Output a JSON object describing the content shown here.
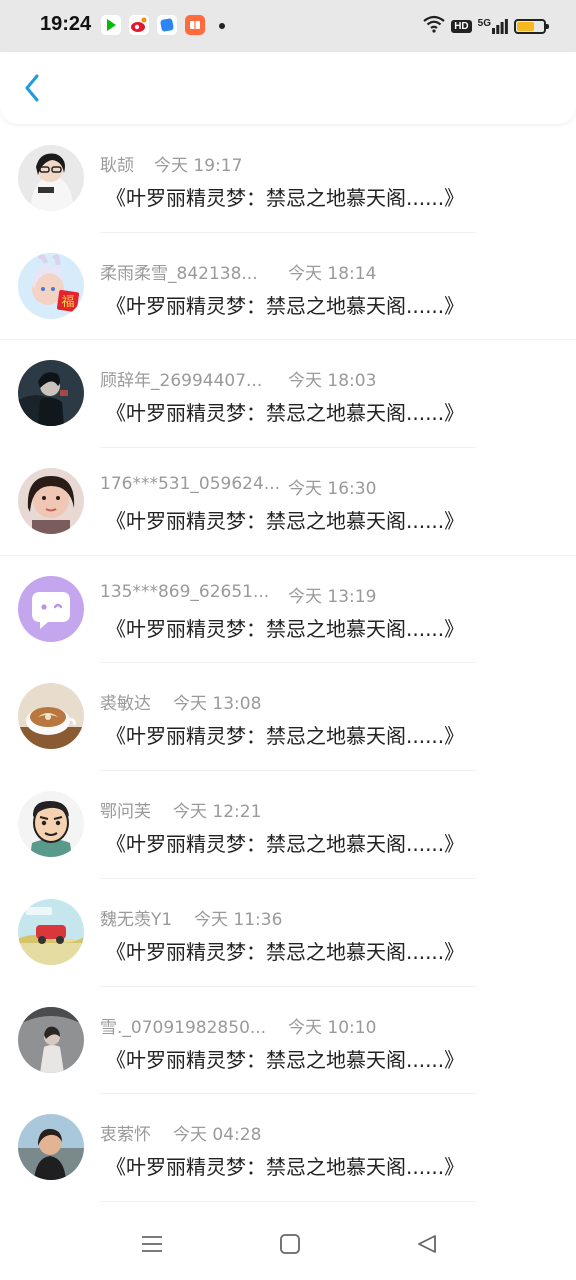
{
  "status_bar": {
    "time": "19:24",
    "badge_hd": "HD",
    "signal": "5G",
    "apps": [
      "iqiyi-app-icon",
      "weibo-app-icon",
      "blue-app-icon",
      "orange-app-icon"
    ]
  },
  "header": {
    "back_icon": "chevron-left-icon",
    "accent": "#1e9be0"
  },
  "messages": [
    {
      "name": "耿颉",
      "time": "今天 19:17",
      "text": "《叶罗丽精灵梦：禁忌之地慕天阁......》"
    },
    {
      "name": "柔雨柔雪_842138...",
      "time": "今天 18:14",
      "text": "《叶罗丽精灵梦：禁忌之地慕天阁......》"
    },
    {
      "name": "顾辞年_26994407...",
      "time": "今天 18:03",
      "text": "《叶罗丽精灵梦：禁忌之地慕天阁......》"
    },
    {
      "name": "176***531_059624...",
      "time": "今天 16:30",
      "text": "《叶罗丽精灵梦：禁忌之地慕天阁......》"
    },
    {
      "name": "135***869_62651...",
      "time": "今天 13:19",
      "text": "《叶罗丽精灵梦：禁忌之地慕天阁......》"
    },
    {
      "name": "裘敏达",
      "time": "今天 13:08",
      "text": "《叶罗丽精灵梦：禁忌之地慕天阁......》"
    },
    {
      "name": "鄂问芙",
      "time": "今天 12:21",
      "text": "《叶罗丽精灵梦：禁忌之地慕天阁......》"
    },
    {
      "name": "魏无羡Y1",
      "time": "今天 11:36",
      "text": "《叶罗丽精灵梦：禁忌之地慕天阁......》"
    },
    {
      "name": "雪._07091982850...",
      "time": "今天 10:10",
      "text": "《叶罗丽精灵梦：禁忌之地慕天阁......》"
    },
    {
      "name": "衷萦怀",
      "time": "今天 04:28",
      "text": "《叶罗丽精灵梦：禁忌之地慕天阁......》"
    }
  ],
  "navigation_bar": {
    "buttons": [
      "menu-icon",
      "home-icon",
      "back-triangle-icon"
    ]
  }
}
